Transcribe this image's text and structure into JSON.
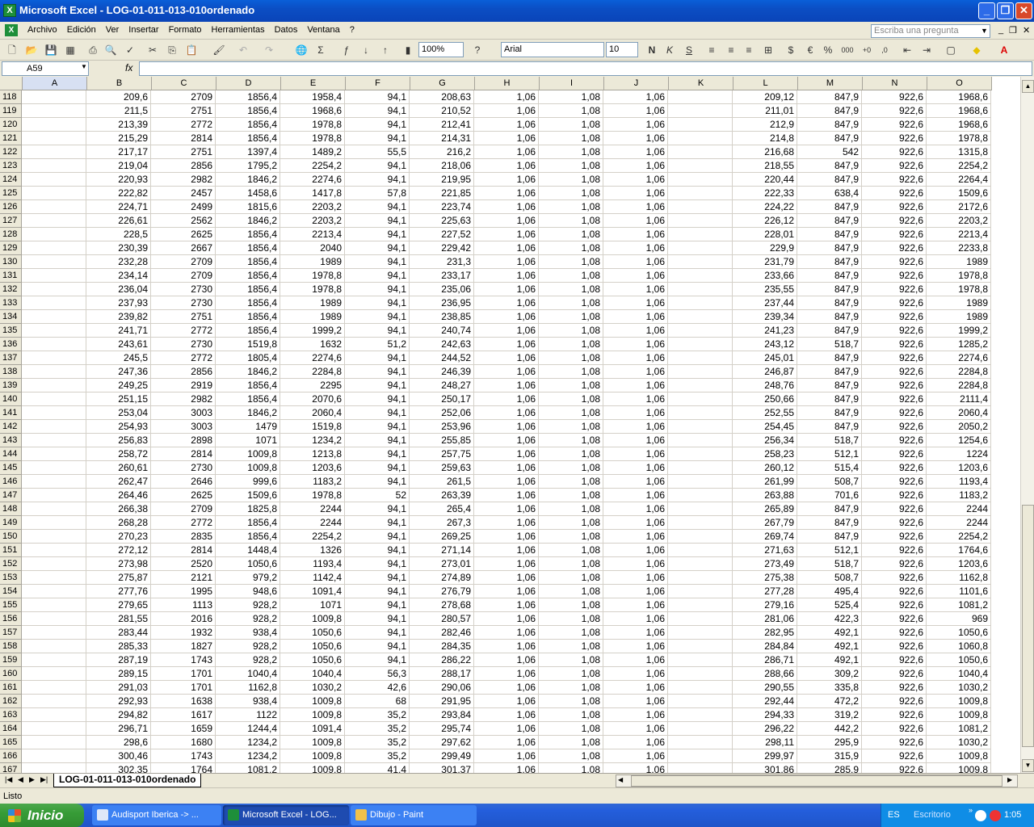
{
  "window": {
    "title": "Microsoft Excel - LOG-01-011-013-010ordenado"
  },
  "menu": [
    "Archivo",
    "Edición",
    "Ver",
    "Insertar",
    "Formato",
    "Herramientas",
    "Datos",
    "Ventana",
    "?"
  ],
  "ask_placeholder": "Escriba una pregunta",
  "toolbar": {
    "zoom": "100%",
    "font": "Arial",
    "size": "10"
  },
  "namebox": "A59",
  "fx_label": "fx",
  "columns": [
    "A",
    "B",
    "C",
    "D",
    "E",
    "F",
    "G",
    "H",
    "I",
    "J",
    "K",
    "L",
    "M",
    "N",
    "O"
  ],
  "rows": [
    [
      "118",
      "",
      "209,6",
      "2709",
      "1856,4",
      "1958,4",
      "94,1",
      "208,63",
      "1,06",
      "1,08",
      "1,06",
      "",
      "209,12",
      "847,9",
      "922,6",
      "1968,6"
    ],
    [
      "119",
      "",
      "211,5",
      "2751",
      "1856,4",
      "1968,6",
      "94,1",
      "210,52",
      "1,06",
      "1,08",
      "1,06",
      "",
      "211,01",
      "847,9",
      "922,6",
      "1968,6"
    ],
    [
      "120",
      "",
      "213,39",
      "2772",
      "1856,4",
      "1978,8",
      "94,1",
      "212,41",
      "1,06",
      "1,08",
      "1,06",
      "",
      "212,9",
      "847,9",
      "922,6",
      "1968,6"
    ],
    [
      "121",
      "",
      "215,29",
      "2814",
      "1856,4",
      "1978,8",
      "94,1",
      "214,31",
      "1,06",
      "1,08",
      "1,06",
      "",
      "214,8",
      "847,9",
      "922,6",
      "1978,8"
    ],
    [
      "122",
      "",
      "217,17",
      "2751",
      "1397,4",
      "1489,2",
      "55,5",
      "216,2",
      "1,06",
      "1,08",
      "1,06",
      "",
      "216,68",
      "542",
      "922,6",
      "1315,8"
    ],
    [
      "123",
      "",
      "219,04",
      "2856",
      "1795,2",
      "2254,2",
      "94,1",
      "218,06",
      "1,06",
      "1,08",
      "1,06",
      "",
      "218,55",
      "847,9",
      "922,6",
      "2254,2"
    ],
    [
      "124",
      "",
      "220,93",
      "2982",
      "1846,2",
      "2274,6",
      "94,1",
      "219,95",
      "1,06",
      "1,08",
      "1,06",
      "",
      "220,44",
      "847,9",
      "922,6",
      "2264,4"
    ],
    [
      "125",
      "",
      "222,82",
      "2457",
      "1458,6",
      "1417,8",
      "57,8",
      "221,85",
      "1,06",
      "1,08",
      "1,06",
      "",
      "222,33",
      "638,4",
      "922,6",
      "1509,6"
    ],
    [
      "126",
      "",
      "224,71",
      "2499",
      "1815,6",
      "2203,2",
      "94,1",
      "223,74",
      "1,06",
      "1,08",
      "1,06",
      "",
      "224,22",
      "847,9",
      "922,6",
      "2172,6"
    ],
    [
      "127",
      "",
      "226,61",
      "2562",
      "1846,2",
      "2203,2",
      "94,1",
      "225,63",
      "1,06",
      "1,08",
      "1,06",
      "",
      "226,12",
      "847,9",
      "922,6",
      "2203,2"
    ],
    [
      "128",
      "",
      "228,5",
      "2625",
      "1856,4",
      "2213,4",
      "94,1",
      "227,52",
      "1,06",
      "1,08",
      "1,06",
      "",
      "228,01",
      "847,9",
      "922,6",
      "2213,4"
    ],
    [
      "129",
      "",
      "230,39",
      "2667",
      "1856,4",
      "2040",
      "94,1",
      "229,42",
      "1,06",
      "1,08",
      "1,06",
      "",
      "229,9",
      "847,9",
      "922,6",
      "2233,8"
    ],
    [
      "130",
      "",
      "232,28",
      "2709",
      "1856,4",
      "1989",
      "94,1",
      "231,3",
      "1,06",
      "1,08",
      "1,06",
      "",
      "231,79",
      "847,9",
      "922,6",
      "1989"
    ],
    [
      "131",
      "",
      "234,14",
      "2709",
      "1856,4",
      "1978,8",
      "94,1",
      "233,17",
      "1,06",
      "1,08",
      "1,06",
      "",
      "233,66",
      "847,9",
      "922,6",
      "1978,8"
    ],
    [
      "132",
      "",
      "236,04",
      "2730",
      "1856,4",
      "1978,8",
      "94,1",
      "235,06",
      "1,06",
      "1,08",
      "1,06",
      "",
      "235,55",
      "847,9",
      "922,6",
      "1978,8"
    ],
    [
      "133",
      "",
      "237,93",
      "2730",
      "1856,4",
      "1989",
      "94,1",
      "236,95",
      "1,06",
      "1,08",
      "1,06",
      "",
      "237,44",
      "847,9",
      "922,6",
      "1989"
    ],
    [
      "134",
      "",
      "239,82",
      "2751",
      "1856,4",
      "1989",
      "94,1",
      "238,85",
      "1,06",
      "1,08",
      "1,06",
      "",
      "239,34",
      "847,9",
      "922,6",
      "1989"
    ],
    [
      "135",
      "",
      "241,71",
      "2772",
      "1856,4",
      "1999,2",
      "94,1",
      "240,74",
      "1,06",
      "1,08",
      "1,06",
      "",
      "241,23",
      "847,9",
      "922,6",
      "1999,2"
    ],
    [
      "136",
      "",
      "243,61",
      "2730",
      "1519,8",
      "1632",
      "51,2",
      "242,63",
      "1,06",
      "1,08",
      "1,06",
      "",
      "243,12",
      "518,7",
      "922,6",
      "1285,2"
    ],
    [
      "137",
      "",
      "245,5",
      "2772",
      "1805,4",
      "2274,6",
      "94,1",
      "244,52",
      "1,06",
      "1,08",
      "1,06",
      "",
      "245,01",
      "847,9",
      "922,6",
      "2274,6"
    ],
    [
      "138",
      "",
      "247,36",
      "2856",
      "1846,2",
      "2284,8",
      "94,1",
      "246,39",
      "1,06",
      "1,08",
      "1,06",
      "",
      "246,87",
      "847,9",
      "922,6",
      "2284,8"
    ],
    [
      "139",
      "",
      "249,25",
      "2919",
      "1856,4",
      "2295",
      "94,1",
      "248,27",
      "1,06",
      "1,08",
      "1,06",
      "",
      "248,76",
      "847,9",
      "922,6",
      "2284,8"
    ],
    [
      "140",
      "",
      "251,15",
      "2982",
      "1856,4",
      "2070,6",
      "94,1",
      "250,17",
      "1,06",
      "1,08",
      "1,06",
      "",
      "250,66",
      "847,9",
      "922,6",
      "2111,4"
    ],
    [
      "141",
      "",
      "253,04",
      "3003",
      "1846,2",
      "2060,4",
      "94,1",
      "252,06",
      "1,06",
      "1,08",
      "1,06",
      "",
      "252,55",
      "847,9",
      "922,6",
      "2060,4"
    ],
    [
      "142",
      "",
      "254,93",
      "3003",
      "1479",
      "1519,8",
      "94,1",
      "253,96",
      "1,06",
      "1,08",
      "1,06",
      "",
      "254,45",
      "847,9",
      "922,6",
      "2050,2"
    ],
    [
      "143",
      "",
      "256,83",
      "2898",
      "1071",
      "1234,2",
      "94,1",
      "255,85",
      "1,06",
      "1,08",
      "1,06",
      "",
      "256,34",
      "518,7",
      "922,6",
      "1254,6"
    ],
    [
      "144",
      "",
      "258,72",
      "2814",
      "1009,8",
      "1213,8",
      "94,1",
      "257,75",
      "1,06",
      "1,08",
      "1,06",
      "",
      "258,23",
      "512,1",
      "922,6",
      "1224"
    ],
    [
      "145",
      "",
      "260,61",
      "2730",
      "1009,8",
      "1203,6",
      "94,1",
      "259,63",
      "1,06",
      "1,08",
      "1,06",
      "",
      "260,12",
      "515,4",
      "922,6",
      "1203,6"
    ],
    [
      "146",
      "",
      "262,47",
      "2646",
      "999,6",
      "1183,2",
      "94,1",
      "261,5",
      "1,06",
      "1,08",
      "1,06",
      "",
      "261,99",
      "508,7",
      "922,6",
      "1193,4"
    ],
    [
      "147",
      "",
      "264,46",
      "2625",
      "1509,6",
      "1978,8",
      "52",
      "263,39",
      "1,06",
      "1,08",
      "1,06",
      "",
      "263,88",
      "701,6",
      "922,6",
      "1183,2"
    ],
    [
      "148",
      "",
      "266,38",
      "2709",
      "1825,8",
      "2244",
      "94,1",
      "265,4",
      "1,06",
      "1,08",
      "1,06",
      "",
      "265,89",
      "847,9",
      "922,6",
      "2244"
    ],
    [
      "149",
      "",
      "268,28",
      "2772",
      "1856,4",
      "2244",
      "94,1",
      "267,3",
      "1,06",
      "1,08",
      "1,06",
      "",
      "267,79",
      "847,9",
      "922,6",
      "2244"
    ],
    [
      "150",
      "",
      "270,23",
      "2835",
      "1856,4",
      "2254,2",
      "94,1",
      "269,25",
      "1,06",
      "1,08",
      "1,06",
      "",
      "269,74",
      "847,9",
      "922,6",
      "2254,2"
    ],
    [
      "151",
      "",
      "272,12",
      "2814",
      "1448,4",
      "1326",
      "94,1",
      "271,14",
      "1,06",
      "1,08",
      "1,06",
      "",
      "271,63",
      "512,1",
      "922,6",
      "1764,6"
    ],
    [
      "152",
      "",
      "273,98",
      "2520",
      "1050,6",
      "1193,4",
      "94,1",
      "273,01",
      "1,06",
      "1,08",
      "1,06",
      "",
      "273,49",
      "518,7",
      "922,6",
      "1203,6"
    ],
    [
      "153",
      "",
      "275,87",
      "2121",
      "979,2",
      "1142,4",
      "94,1",
      "274,89",
      "1,06",
      "1,08",
      "1,06",
      "",
      "275,38",
      "508,7",
      "922,6",
      "1162,8"
    ],
    [
      "154",
      "",
      "277,76",
      "1995",
      "948,6",
      "1091,4",
      "94,1",
      "276,79",
      "1,06",
      "1,08",
      "1,06",
      "",
      "277,28",
      "495,4",
      "922,6",
      "1101,6"
    ],
    [
      "155",
      "",
      "279,65",
      "1113",
      "928,2",
      "1071",
      "94,1",
      "278,68",
      "1,06",
      "1,08",
      "1,06",
      "",
      "279,16",
      "525,4",
      "922,6",
      "1081,2"
    ],
    [
      "156",
      "",
      "281,55",
      "2016",
      "928,2",
      "1009,8",
      "94,1",
      "280,57",
      "1,06",
      "1,08",
      "1,06",
      "",
      "281,06",
      "422,3",
      "922,6",
      "969"
    ],
    [
      "157",
      "",
      "283,44",
      "1932",
      "938,4",
      "1050,6",
      "94,1",
      "282,46",
      "1,06",
      "1,08",
      "1,06",
      "",
      "282,95",
      "492,1",
      "922,6",
      "1050,6"
    ],
    [
      "158",
      "",
      "285,33",
      "1827",
      "928,2",
      "1050,6",
      "94,1",
      "284,35",
      "1,06",
      "1,08",
      "1,06",
      "",
      "284,84",
      "492,1",
      "922,6",
      "1060,8"
    ],
    [
      "159",
      "",
      "287,19",
      "1743",
      "928,2",
      "1050,6",
      "94,1",
      "286,22",
      "1,06",
      "1,08",
      "1,06",
      "",
      "286,71",
      "492,1",
      "922,6",
      "1050,6"
    ],
    [
      "160",
      "",
      "289,15",
      "1701",
      "1040,4",
      "1040,4",
      "56,3",
      "288,17",
      "1,06",
      "1,08",
      "1,06",
      "",
      "288,66",
      "309,2",
      "922,6",
      "1040,4"
    ],
    [
      "161",
      "",
      "291,03",
      "1701",
      "1162,8",
      "1030,2",
      "42,6",
      "290,06",
      "1,06",
      "1,08",
      "1,06",
      "",
      "290,55",
      "335,8",
      "922,6",
      "1030,2"
    ],
    [
      "162",
      "",
      "292,93",
      "1638",
      "938,4",
      "1009,8",
      "68",
      "291,95",
      "1,06",
      "1,08",
      "1,06",
      "",
      "292,44",
      "472,2",
      "922,6",
      "1009,8"
    ],
    [
      "163",
      "",
      "294,82",
      "1617",
      "1122",
      "1009,8",
      "35,2",
      "293,84",
      "1,06",
      "1,08",
      "1,06",
      "",
      "294,33",
      "319,2",
      "922,6",
      "1009,8"
    ],
    [
      "164",
      "",
      "296,71",
      "1659",
      "1244,4",
      "1091,4",
      "35,2",
      "295,74",
      "1,06",
      "1,08",
      "1,06",
      "",
      "296,22",
      "442,2",
      "922,6",
      "1081,2"
    ],
    [
      "165",
      "",
      "298,6",
      "1680",
      "1234,2",
      "1009,8",
      "35,2",
      "297,62",
      "1,06",
      "1,08",
      "1,06",
      "",
      "298,11",
      "295,9",
      "922,6",
      "1030,2"
    ],
    [
      "166",
      "",
      "300,46",
      "1743",
      "1234,2",
      "1009,8",
      "35,2",
      "299,49",
      "1,06",
      "1,08",
      "1,06",
      "",
      "299,97",
      "315,9",
      "922,6",
      "1009,8"
    ],
    [
      "167",
      "",
      "302,35",
      "1764",
      "1081,2",
      "1009,8",
      "41,4",
      "301,37",
      "1,06",
      "1,08",
      "1,06",
      "",
      "301,86",
      "285,9",
      "922,6",
      "1009,8"
    ]
  ],
  "sheet_tab": "LOG-01-011-013-010ordenado",
  "status": "Listo",
  "taskbar": {
    "start": "Inicio",
    "tasks": [
      "Audisport Iberica -> ...",
      "Microsoft Excel - LOG...",
      "Dibujo - Paint"
    ],
    "lang": "ES",
    "desktop": "Escritorio",
    "clock": "1:05"
  }
}
